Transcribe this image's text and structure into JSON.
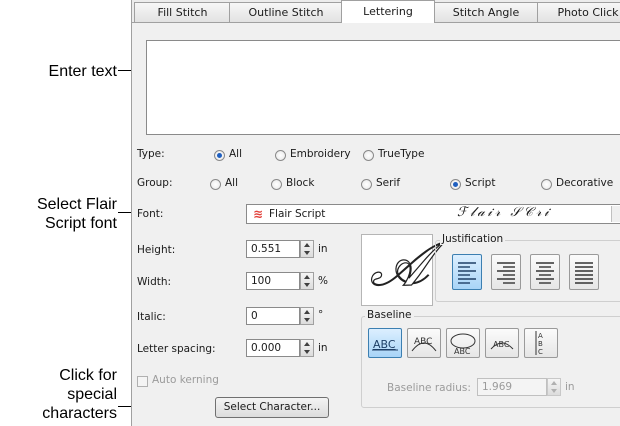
{
  "annotations": {
    "enter_text": "Enter text",
    "select_font_line1": "Select Flair",
    "select_font_line2": "Script font",
    "special_line1": "Click for",
    "special_line2": "special",
    "special_line3": "characters"
  },
  "tabs": [
    {
      "label": "Fill Stitch"
    },
    {
      "label": "Outline Stitch"
    },
    {
      "label": "Lettering",
      "active": true
    },
    {
      "label": "Stitch Angle"
    },
    {
      "label": "Photo Click"
    }
  ],
  "type_row": {
    "label": "Type:",
    "options": [
      "All",
      "Embroidery",
      "TrueType"
    ],
    "selected": "All"
  },
  "group_row": {
    "label": "Group:",
    "options": [
      "All",
      "Block",
      "Serif",
      "Script",
      "Decorative"
    ],
    "selected": "Script"
  },
  "font_row": {
    "label": "Font:",
    "value": "Flair Script",
    "sample": "ℱ𝓁𝒶𝒾𝓇 𝒮𝒞𝓇𝒾",
    "icon": "truetype-font-icon"
  },
  "height": {
    "label": "Height:",
    "value": "0.551",
    "unit": "in"
  },
  "width": {
    "label": "Width:",
    "value": "100",
    "unit": "%"
  },
  "italic": {
    "label": "Italic:",
    "value": "0",
    "unit": "°"
  },
  "letter_spacing": {
    "label": "Letter spacing:",
    "value": "0.000",
    "unit": "in"
  },
  "auto_kerning": {
    "label": "Auto kerning",
    "checked": false
  },
  "preview_glyph": "𝒜",
  "justification": {
    "title": "Justification",
    "options": [
      "left",
      "right",
      "center",
      "full"
    ],
    "selected": "left"
  },
  "baseline": {
    "title": "Baseline",
    "options": [
      "straight",
      "arc-top",
      "arc-bottom",
      "circle",
      "vertical"
    ],
    "selected": "straight",
    "radius_label": "Baseline radius:",
    "radius_value": "1.969",
    "radius_unit": "in"
  },
  "select_character_button": "Select Character...",
  "colors": {
    "accent": "#1f5fbf",
    "font_icon": "#e2403a"
  }
}
